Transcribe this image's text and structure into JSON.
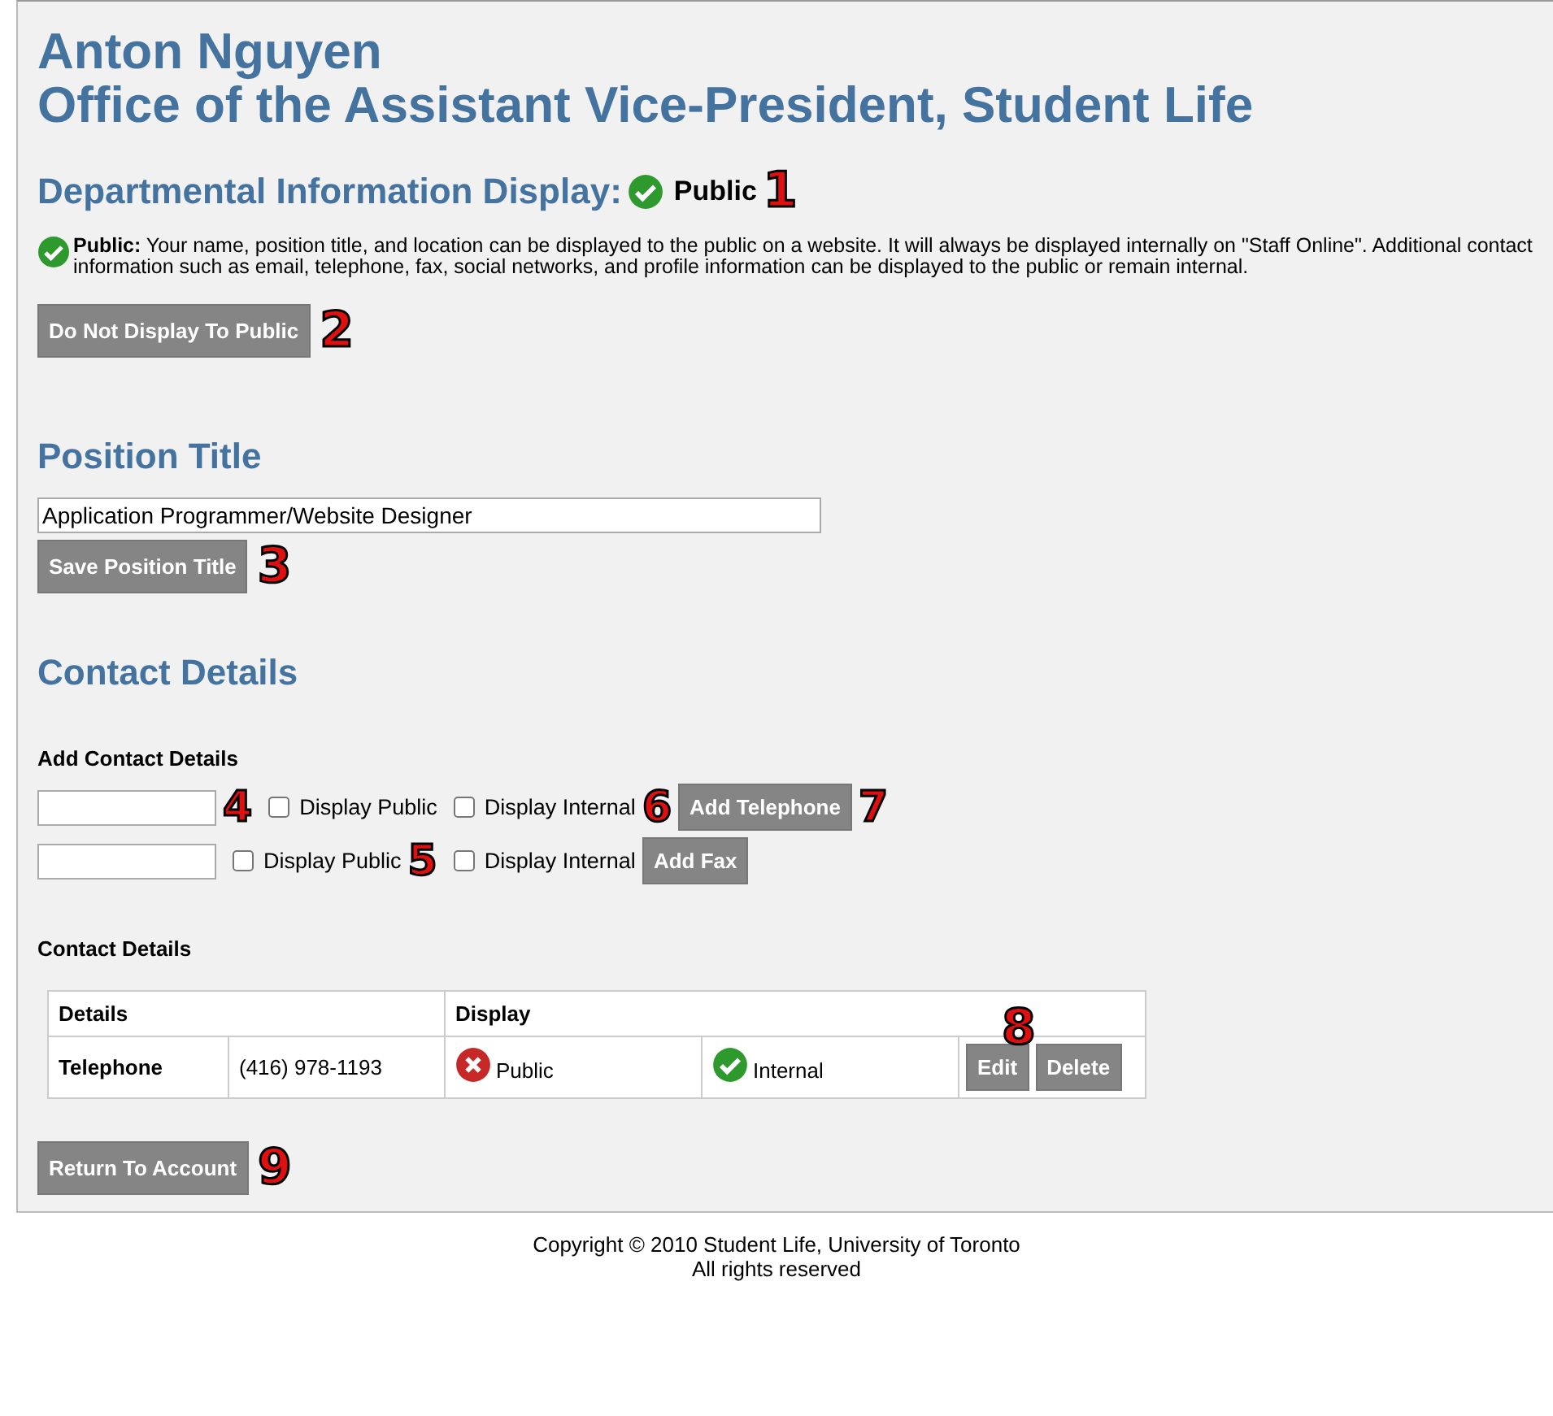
{
  "header": {
    "name": "Anton Nguyen",
    "office": "Office of the Assistant Vice-President, Student Life"
  },
  "department_display": {
    "label": "Departmental Information Display:",
    "status": "Public",
    "public": true,
    "callout": "1"
  },
  "notice": {
    "public": true,
    "status": "Public:",
    "text": "Your name, position title, and location can be displayed to the public on a website. It will always be displayed internally on \"Staff Online\". Additional contact information such as email, telephone, fax, social networks, and profile information can be displayed to the public or remain internal."
  },
  "toggle_button": {
    "label": "Do Not Display To Public",
    "callout": "2"
  },
  "position_title": {
    "heading": "Position Title",
    "value": "Application Programmer/Website Designer",
    "button": "Save Position Title",
    "callout": "3"
  },
  "contact_details": {
    "heading": "Contact Details",
    "add_heading": "Add Contact Details",
    "add_rows": [
      {
        "field_callout": "4",
        "public_label": "Display Public",
        "public_checked": false,
        "public_callout": "",
        "internal_label": "Display Internal",
        "internal_checked": false,
        "internal_callout": "6",
        "button": "Add Telephone",
        "button_callout": "7"
      },
      {
        "field_callout": "",
        "public_label": "Display Public",
        "public_checked": false,
        "public_callout": "5",
        "internal_label": "Display Internal",
        "internal_checked": false,
        "internal_callout": "",
        "button": "Add Fax",
        "button_callout": ""
      }
    ],
    "list_heading": "Contact Details",
    "table": {
      "columns": [
        "Details",
        "Display"
      ],
      "rows": [
        {
          "type": "Telephone",
          "value": "(416) 978-1193",
          "public_label": "Public",
          "public": false,
          "internal_label": "Internal",
          "internal": true,
          "actions": [
            "Edit",
            "Delete"
          ],
          "callout": "8"
        }
      ]
    }
  },
  "return_button": {
    "label": "Return To Account",
    "callout": "9"
  },
  "footer": [
    "Copyright © 2010 Student Life, University of Toronto",
    "All rights reserved"
  ]
}
